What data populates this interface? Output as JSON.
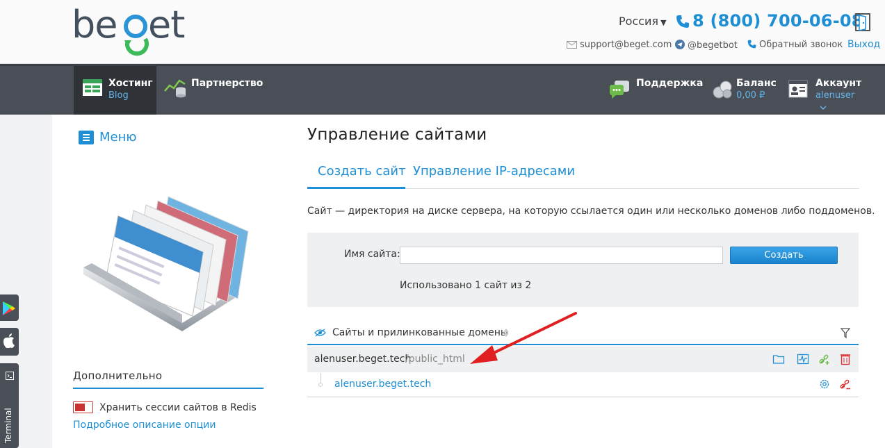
{
  "header": {
    "region": "Россия",
    "phone": "8 (800) 700-06-08",
    "support_email": "support@beget.com",
    "telegram": "@begetbot",
    "callback": "Обратный звонок",
    "logout": "Выход",
    "brand_color": "#1e8fd4"
  },
  "nav": {
    "hosting": {
      "title": "Хостинг",
      "subtitle": "Blog"
    },
    "partner": {
      "title": "Партнерство"
    },
    "support": {
      "title": "Поддержка"
    },
    "balance": {
      "title": "Баланс",
      "subtitle": "0,00 ₽"
    },
    "account": {
      "title": "Аккаунт",
      "subtitle": "alenuser"
    }
  },
  "sidebar": {
    "menu_label": "Меню",
    "extra_title": "Дополнительно",
    "redis_label": "Хранить сессии сайтов в Redis",
    "option_link": "Подробное описание опции",
    "terminal_label": "Terminal"
  },
  "main": {
    "title": "Управление сайтами",
    "tabs": [
      {
        "label": "Создать сайт",
        "active": true
      },
      {
        "label": "Управление IP-адресами",
        "active": false
      }
    ],
    "description": "Сайт — директория на диске сервера, на которую ссылается один или несколько доменов либо поддоменов.",
    "form": {
      "site_name_label": "Имя сайта:",
      "site_name_value": "",
      "create_button": "Создать",
      "usage": "Использовано 1 сайт из 2"
    },
    "list": {
      "header": "Сайты и прилинкованные домены",
      "site_host": "alenuser.beget.tech",
      "site_path": "/public_html",
      "linked_domain": "alenuser.beget.tech"
    }
  }
}
